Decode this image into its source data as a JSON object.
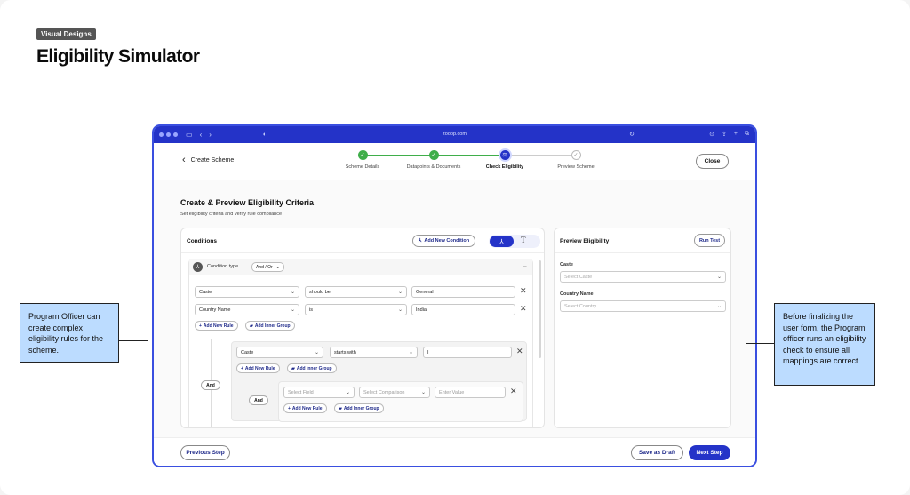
{
  "tag": "Visual Designs",
  "page_title": "Eligibility Simulator",
  "browser": {
    "url": "zooop.com"
  },
  "topbar": {
    "back_label": "Create Scheme",
    "steps": [
      {
        "label": "Scheme Details",
        "state": "done"
      },
      {
        "label": "Datapoints & Documents",
        "state": "done"
      },
      {
        "label": "Check Eligibility",
        "state": "active"
      },
      {
        "label": "Preview Scheme",
        "state": "todo"
      }
    ],
    "close_label": "Close"
  },
  "section": {
    "title": "Create & Preview Eligibility Criteria",
    "subtitle": "Set eligibility criteria and verify rule compliance"
  },
  "conditions": {
    "title": "Conditions",
    "add_condition_label": "Add New Condition",
    "toggle_text_glyph": "T",
    "group": {
      "type_label": "Condition type",
      "type_value": "And / Or",
      "rules": [
        {
          "field": "Caste",
          "comparison": "should be",
          "value": "General"
        },
        {
          "field": "Country Name",
          "comparison": "is",
          "value": "India"
        }
      ],
      "add_rule_label": "Add New Rule",
      "add_group_label": "Add Inner Group",
      "and_label": "And",
      "nested": {
        "rule": {
          "field": "Caste",
          "comparison": "starts with",
          "value": "I"
        },
        "inner": {
          "field_placeholder": "Select Field",
          "comparison_placeholder": "Select Comparison",
          "value_placeholder": "Enter Value"
        }
      }
    }
  },
  "preview": {
    "title": "Preview Eligibility",
    "run_label": "Run Test",
    "fields": [
      {
        "label": "Caste",
        "placeholder": "Select Caste"
      },
      {
        "label": "Country Name",
        "placeholder": "Select Country"
      }
    ]
  },
  "footer": {
    "previous_label": "Previous Step",
    "draft_label": "Save as Draft",
    "next_label": "Next Step"
  },
  "notes": {
    "left": "Program Officer can create complex eligibility rules for the scheme.",
    "right": "Before finalizing the user form, the Program officer runs an eligibility check to ensure all mappings are correct."
  },
  "colors": {
    "brand": "#2433c8",
    "success": "#3fae4a",
    "note_bg": "#bcdcff"
  }
}
